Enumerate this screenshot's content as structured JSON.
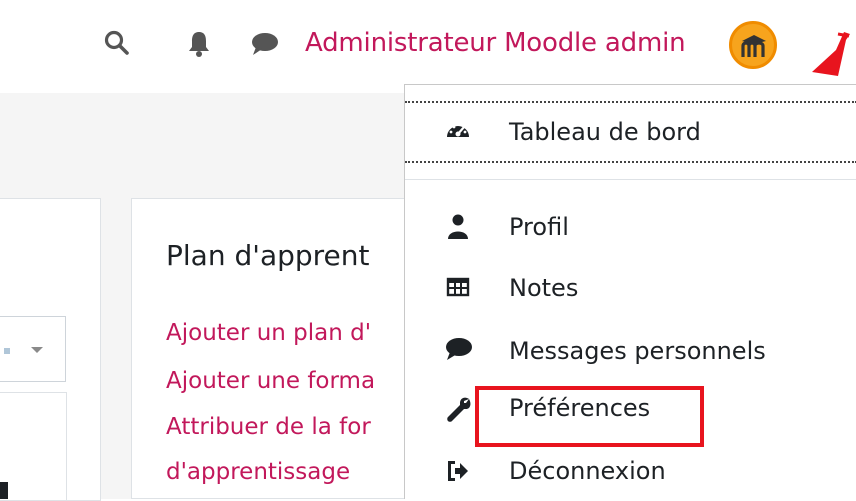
{
  "navbar": {
    "user_name": "Administrateur Moodle admin",
    "icons": [
      "search-icon",
      "bell-icon",
      "message-bubble-icon"
    ]
  },
  "card": {
    "title": "Plan d'apprent",
    "links": [
      "Ajouter un plan d'",
      "Ajouter une forma",
      "Attribuer de la for",
      "d'apprentissage"
    ]
  },
  "user_menu": {
    "items": [
      {
        "label": "Tableau de bord",
        "icon": "dashboard-icon"
      },
      {
        "label": "Profil",
        "icon": "user-icon"
      },
      {
        "label": "Notes",
        "icon": "table-icon"
      },
      {
        "label": "Messages personnels",
        "icon": "comment-icon"
      },
      {
        "label": "Préférences",
        "icon": "wrench-icon"
      },
      {
        "label": "Déconnexion",
        "icon": "sign-out-icon"
      }
    ]
  },
  "colors": {
    "accent": "#c2185b",
    "annotation": "#e8141e",
    "avatar_bg": "#f7a41d"
  }
}
